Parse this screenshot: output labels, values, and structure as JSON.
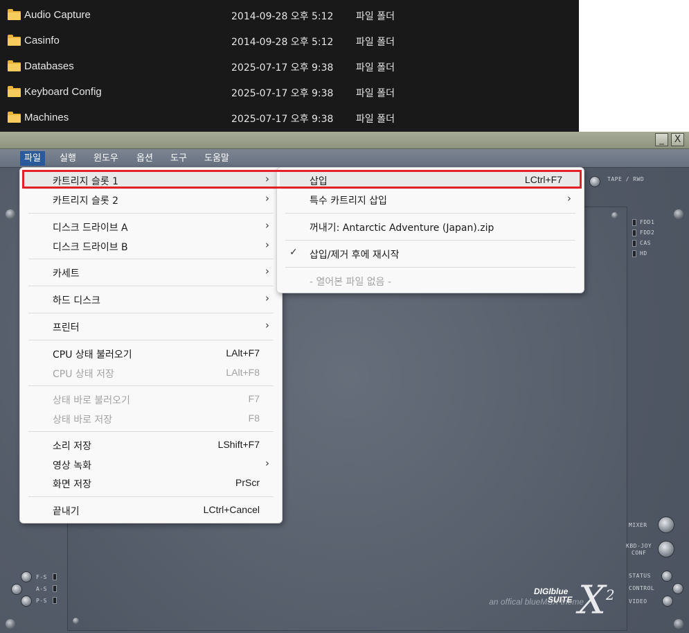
{
  "explorer": {
    "rows": [
      {
        "name": "Audio Capture",
        "date": "2014-09-28 오후 5:12",
        "type": "파일 폴더"
      },
      {
        "name": "Casinfo",
        "date": "2014-09-28 오후 5:12",
        "type": "파일 폴더"
      },
      {
        "name": "Databases",
        "date": "2025-07-17 오후 9:38",
        "type": "파일 폴더"
      },
      {
        "name": "Keyboard Config",
        "date": "2025-07-17 오후 9:38",
        "type": "파일 폴더"
      },
      {
        "name": "Machines",
        "date": "2025-07-17 오후 9:38",
        "type": "파일 폴더"
      }
    ]
  },
  "window": {
    "minimize": "_",
    "close": "X"
  },
  "menubar": [
    "파일",
    "실행",
    "윈도우",
    "옵션",
    "도구",
    "도움말"
  ],
  "file_menu": {
    "items": [
      {
        "label": "카트리지 슬롯 1",
        "shortcut": "",
        "submenu": true,
        "disabled": false,
        "highlighted": true
      },
      {
        "label": "카트리지 슬롯 2",
        "shortcut": "",
        "submenu": true,
        "disabled": false
      },
      {
        "label": "디스크 드라이브 A",
        "shortcut": "",
        "submenu": true,
        "disabled": false
      },
      {
        "label": "디스크 드라이브 B",
        "shortcut": "",
        "submenu": true,
        "disabled": false
      },
      {
        "label": "카세트",
        "shortcut": "",
        "submenu": true,
        "disabled": false
      },
      {
        "label": "하드 디스크",
        "shortcut": "",
        "submenu": true,
        "disabled": false
      },
      {
        "label": "프린터",
        "shortcut": "",
        "submenu": true,
        "disabled": false
      },
      {
        "label": "CPU 상태 불러오기",
        "shortcut": "LAlt+F7",
        "submenu": false,
        "disabled": false
      },
      {
        "label": "CPU 상태 저장",
        "shortcut": "LAlt+F8",
        "submenu": false,
        "disabled": true
      },
      {
        "label": "상태 바로 불러오기",
        "shortcut": "F7",
        "submenu": false,
        "disabled": true
      },
      {
        "label": "상태 바로 저장",
        "shortcut": "F8",
        "submenu": false,
        "disabled": true
      },
      {
        "label": "소리 저장",
        "shortcut": "LShift+F7",
        "submenu": false,
        "disabled": false
      },
      {
        "label": "영상 녹화",
        "shortcut": "",
        "submenu": true,
        "disabled": false
      },
      {
        "label": "화면 저장",
        "shortcut": "PrScr",
        "submenu": false,
        "disabled": false
      },
      {
        "label": "끝내기",
        "shortcut": "LCtrl+Cancel",
        "submenu": false,
        "disabled": false
      }
    ]
  },
  "cart_menu": {
    "items": [
      {
        "label": "삽입",
        "shortcut": "LCtrl+F7",
        "submenu": false,
        "checked": false,
        "disabled": false
      },
      {
        "label": "특수 카트리지 삽입",
        "shortcut": "",
        "submenu": true,
        "checked": false,
        "disabled": false
      },
      {
        "label": "꺼내기: Antarctic Adventure (Japan).zip",
        "shortcut": "",
        "submenu": false,
        "checked": false,
        "disabled": false
      },
      {
        "label": "삽입/제거 후에 재시작",
        "shortcut": "",
        "submenu": false,
        "checked": true,
        "disabled": false
      },
      {
        "label": "- 열어본 파일 없음 -",
        "shortcut": "",
        "submenu": false,
        "checked": false,
        "disabled": true
      }
    ]
  },
  "panel": {
    "tape_label": "TAPE / RWD",
    "leds_right": [
      "FDD1",
      "FDD2",
      "CAS",
      "HD"
    ],
    "leds_left": [
      "F-S",
      "A-S",
      "P-S"
    ],
    "mixer": "MIXER",
    "kbd_joy": "KBD-JOY",
    "conf": "CONF",
    "status": "STATUS",
    "control": "CONTROL",
    "video": "VIDEO",
    "brand_tag": "an offical blueMSX theme",
    "brand_name_1": "DIGIblue",
    "brand_name_2": "SUITE",
    "brand_x": "X",
    "brand_sup": "2"
  },
  "colors": {
    "highlight_box": "#e3202a",
    "menu_active": "#2a5a9a",
    "explorer_bg": "#191919",
    "folder": "#f6cd5c"
  }
}
